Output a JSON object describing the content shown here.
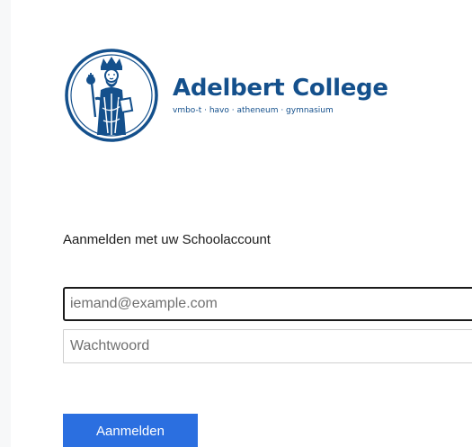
{
  "brand": {
    "name": "Adelbert College",
    "tagline": "vmbo-t · havo · atheneum · gymnasium",
    "color": "#14508c"
  },
  "form": {
    "heading": "Aanmelden met uw Schoolaccount",
    "email_placeholder": "iemand@example.com",
    "password_placeholder": "Wachtwoord",
    "submit_label": "Aanmelden",
    "submit_color": "#2b6fe0"
  }
}
